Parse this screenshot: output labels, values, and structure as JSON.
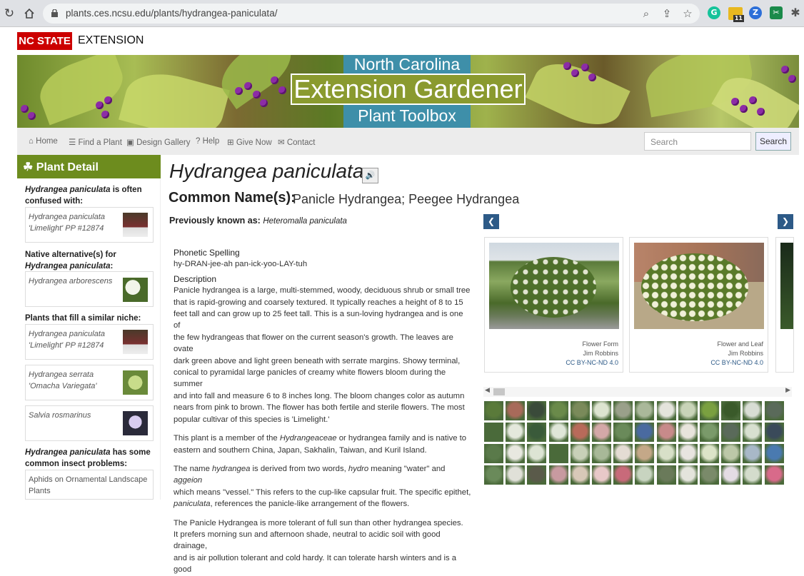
{
  "browser": {
    "url": "plants.ces.ncsu.edu/plants/hydrangea-paniculata/",
    "icons": [
      "reload-icon",
      "home-icon",
      "lock-icon",
      "zoom-icon",
      "share-icon",
      "star-icon",
      "grammarly-icon",
      "calendar-icon",
      "zoom-ext-icon",
      "snip-icon",
      "extensions-icon"
    ],
    "calendar_badge": "11",
    "zoom_ext_letter": "Z",
    "grammarly_letter": "G"
  },
  "header": {
    "nc_state": "NC STATE",
    "extension": "EXTENSION"
  },
  "banner": {
    "line1": "North Carolina",
    "line2": "Extension Gardener",
    "line3": "Plant Toolbox"
  },
  "nav": {
    "items": [
      {
        "label": "Home",
        "icon": "home-icon"
      },
      {
        "label": "Find a Plant",
        "icon": "list-icon"
      },
      {
        "label": "Design Gallery",
        "icon": "image-icon"
      },
      {
        "label": "Help",
        "icon": "question-icon"
      },
      {
        "label": "Give Now",
        "icon": "gift-icon"
      },
      {
        "label": "Contact",
        "icon": "envelope-icon"
      }
    ],
    "search_placeholder": "Search",
    "search_button": "Search"
  },
  "sidebar": {
    "heading": "Plant Detail",
    "confused": {
      "species": "Hydrangea paniculata",
      "rest": " is often confused with:"
    },
    "confused_items": [
      {
        "name": "Hydrangea paniculata 'Limelight' PP #12874",
        "color": "#6b2a2a"
      }
    ],
    "native": {
      "pre": "Native alternative(s) for ",
      "species": "Hydrangea paniculata",
      "post": ":"
    },
    "native_items": [
      {
        "name": "Hydrangea arborescens",
        "color": "#e8f0d8"
      }
    ],
    "niche_label": "Plants that fill a similar niche:",
    "niche_items": [
      {
        "name": "Hydrangea paniculata 'Limelight' PP #12874",
        "color": "#6b2a2a"
      },
      {
        "name": "Hydrangea serrata 'Omacha Variegata'",
        "color": "#9cbb58"
      },
      {
        "name": "Salvia rosmarinus",
        "color": "#b8a6d8"
      }
    ],
    "insect": {
      "species": "Hydrangea paniculata",
      "rest": " has some common insect problems:"
    },
    "insect_items": [
      {
        "name": "Aphids on Ornamental Landscape Plants"
      }
    ]
  },
  "main": {
    "title": "Hydrangea paniculata",
    "speaker_icon": "speaker-icon",
    "common_label": "Common Name(s):",
    "common_names": "Panicle Hydrangea;  Peegee Hydrangea",
    "prev_label": "Previously known as:",
    "prev_value": "Heteromalla paniculata",
    "phonetic_label": "Phonetic Spelling",
    "phonetic_value": "hy-DRAN-jee-ah pan-ick-yoo-LAY-tuh",
    "description_label": "Description",
    "description_lines": [
      "Panicle hydrangea is a large, multi-stemmed, woody, deciduous shrub or small tree",
      "that is rapid-growing and coarsely textured. It typically reaches a height of 8 to 15",
      "feet tall and can grow up to 25 feet tall. This is a sun-loving hydrangea and is one of",
      "the few hydrangeas that flower on the current season's growth. The leaves are ovate",
      "dark green above and light green beneath with serrate margins. Showy terminal,",
      "conical to pyramidal large panicles of creamy white flowers bloom during the summer",
      "and into fall and measure 6 to 8 inches long. The bloom changes color as autumn",
      "nears from pink to brown. The flower has both fertile and sterile flowers. The most",
      "popular cultivar of this species is 'Limelight.'"
    ],
    "family_p1": "This plant is a member of the ",
    "family_name": "Hydrangeaceae",
    "family_p2": " or hydrangea family and is native to",
    "family_line2": "eastern and southern China, Japan, Sakhalin, Taiwan, and Kuril Island.",
    "name_p1": "The name ",
    "name_hydrangea": "hydrangea",
    "name_p2": " is derived from two words, ",
    "name_hydro": "hydro",
    "name_p3": " meaning \"water\" and ",
    "name_aggeion": "aggeion",
    "name_line2": "which means \"vessel.\" This refers to the cup-like capsular fruit. The specific epithet,",
    "name_paniculata": "paniculata",
    "name_line3": ", references the panicle-like arrangement of the flowers.",
    "last_lines": [
      "The Panicle Hydrangea is more tolerant of full sun than other hydrangea species.",
      "It prefers morning sun and afternoon shade, neutral to acidic soil with good drainage,",
      "and is air pollution tolerant and cold hardy. It can tolerate harsh winters and is a good"
    ]
  },
  "gallery": {
    "prev_icon": "chevron-left-icon",
    "next_icon": "chevron-right-icon",
    "cards": [
      {
        "caption": "Flower Form",
        "author": "Jim Robbins",
        "license": "CC BY-NC-ND 4.0"
      },
      {
        "caption": "Flower and Leaf",
        "author": "Jim Robbins",
        "license": "CC BY-NC-ND 4.0"
      }
    ],
    "thumb_colors": [
      "#5a7a3a",
      "#a86a5a",
      "#3a4a3a",
      "#6a8a4a",
      "#7a8a5a",
      "#dde4d0",
      "#9aa08a",
      "#aab89a",
      "#e4e4dc",
      "#c8d4b8",
      "#7aa040",
      "#3a5a2a",
      "#d8ddd4",
      "#5a6a5a",
      "#4a6a3a",
      "#e4e8dc",
      "#3a5a3a",
      "#dfe6d8",
      "#b86a5a",
      "#d4a8a8",
      "#6a8a5a",
      "#4a6aa0",
      "#c88a8a",
      "#e8e4dc",
      "#7a9a6a",
      "#5a6a5a",
      "#d8e0d0",
      "#3a4a5a",
      "#5a7a4a",
      "#e8e8e0",
      "#dde4d4",
      "#4a6a3a",
      "#c8d0b8",
      "#a8b898",
      "#e4dcd4",
      "#c4a888",
      "#d8e0c8",
      "#e8e4e0",
      "#dce4c8",
      "#bcc8a8",
      "#a8b8c8",
      "#4a7ab0",
      "#6a8a5a",
      "#e0e0d8",
      "#5a5a4a",
      "#c89aa0",
      "#d8c8b8",
      "#e8c8c8",
      "#c86a7a",
      "#c8d4c0",
      "#6a7a5a",
      "#e4e4dc",
      "#7a8a6a",
      "#e4dce4",
      "#d4dccc",
      "#d86a8a"
    ]
  }
}
